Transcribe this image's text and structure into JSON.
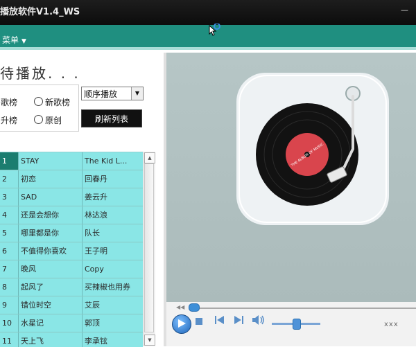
{
  "window": {
    "title": "播放软件V1.4_WS",
    "minimize_label": "—"
  },
  "menu": {
    "label": "菜单",
    "caret": "▼"
  },
  "status_text": "待播放. . .",
  "chart_options": {
    "items": [
      {
        "label": "热歌榜",
        "shown": "歌榜"
      },
      {
        "label": "新歌榜"
      },
      {
        "label": "飙升榜",
        "shown": "升榜"
      },
      {
        "label": "原创"
      }
    ]
  },
  "play_mode": {
    "selected": "顺序播放"
  },
  "refresh_label": "刷新列表",
  "playlist": {
    "rows": [
      {
        "num": "1",
        "title": "STAY",
        "artist": "The Kid L..."
      },
      {
        "num": "2",
        "title": "初恋",
        "artist": "回春丹"
      },
      {
        "num": "3",
        "title": "SAD",
        "artist": "姜云升"
      },
      {
        "num": "4",
        "title": "还是会想你",
        "artist": "林达浪"
      },
      {
        "num": "5",
        "title": "哪里都是你",
        "artist": "队长"
      },
      {
        "num": "6",
        "title": "不值得你喜欢",
        "artist": "王子明"
      },
      {
        "num": "7",
        "title": "晚风",
        "artist": "Copy"
      },
      {
        "num": "8",
        "title": "起风了",
        "artist": "买辣椒也用券"
      },
      {
        "num": "9",
        "title": "错位时空",
        "artist": "艾辰"
      },
      {
        "num": "10",
        "title": "水星记",
        "artist": "郭顶"
      },
      {
        "num": "11",
        "title": "天上飞",
        "artist": "李承铉"
      }
    ],
    "selected_index": 0
  },
  "album_art": {
    "record_label": "THE ALBUM OF MUSIC",
    "colors": {
      "tile": "#eef2f4",
      "vinyl": "#121212",
      "label": "#d9454d",
      "arm": "#dcdcdc"
    }
  },
  "controls": {
    "progress": 0.0,
    "volume": 0.5,
    "time_text": "xxx"
  },
  "colors": {
    "accent": "#1f8f80",
    "list_row": "#8ae6e6",
    "list_selected": "#1b7d6f"
  }
}
